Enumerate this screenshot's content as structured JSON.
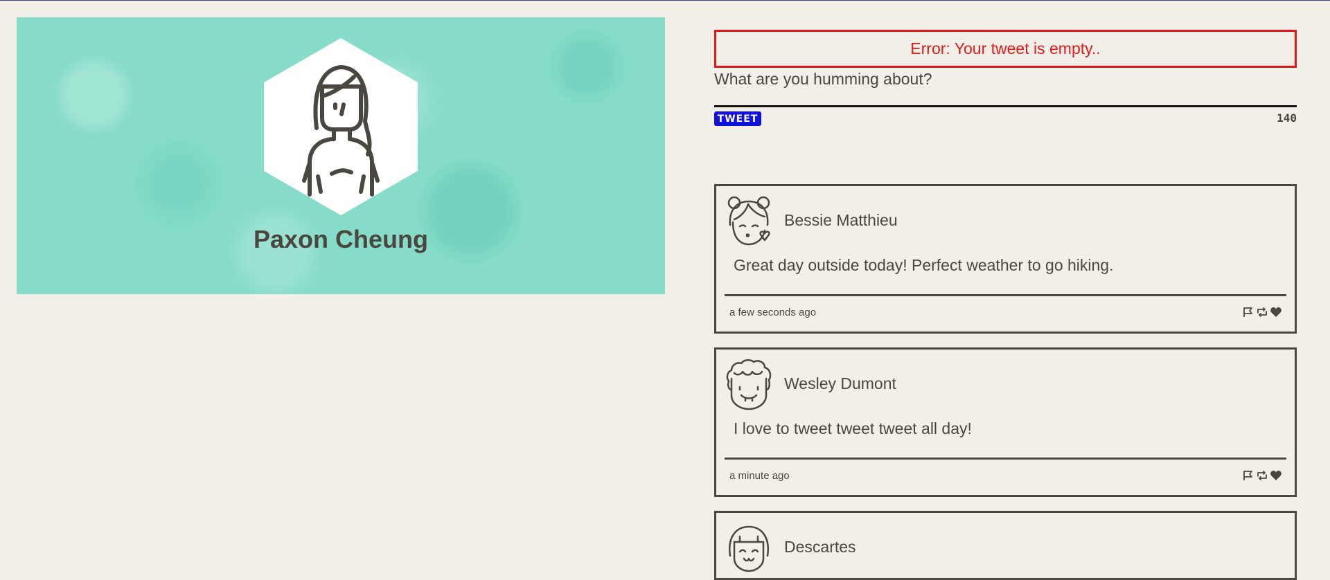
{
  "profile": {
    "name": "Paxon Cheung",
    "avatar_icon": "woman-long-hair-avatar-icon",
    "banner_color": "#86dcc8"
  },
  "compose": {
    "error_text": "Error: Your tweet is empty..",
    "placeholder": "What are you humming about?",
    "button_label": "TWEET",
    "char_count": "140",
    "error_color": "#e01919",
    "button_color": "#1111dd"
  },
  "tweets": [
    {
      "author": "Bessie Matthieu",
      "text": "Great day outside today! Perfect weather to go hiking.",
      "time": "a few seconds ago",
      "avatar_icon": "girl-buns-kiss-avatar-icon"
    },
    {
      "author": "Wesley Dumont",
      "text": "I love to tweet tweet tweet all day!",
      "time": "a minute ago",
      "avatar_icon": "curly-hair-man-avatar-icon"
    },
    {
      "author": "Descartes",
      "avatar_icon": "bob-hair-smile-avatar-icon"
    }
  ]
}
